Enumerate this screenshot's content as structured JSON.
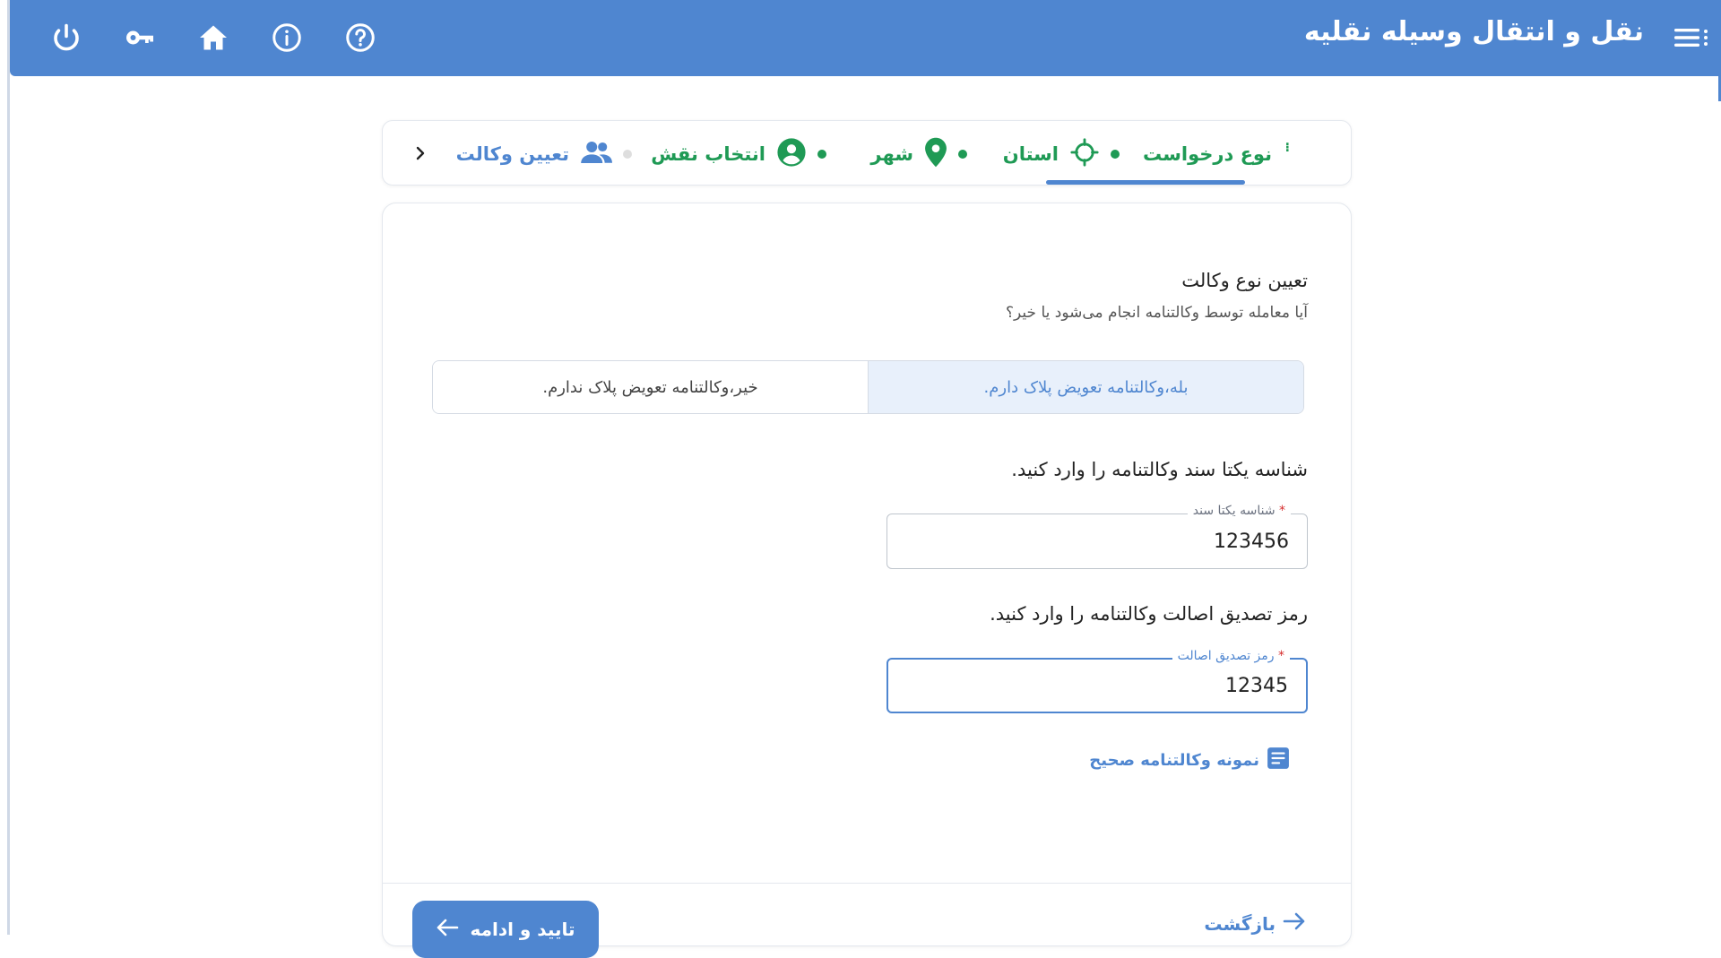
{
  "header": {
    "title": "نقل و انتقال وسیله نقلیه",
    "menu_icon": "menu-icon",
    "icons": [
      "power-icon",
      "key-icon",
      "home-icon",
      "info-icon",
      "help-icon"
    ],
    "color": "#4f86d0"
  },
  "stepper": {
    "steps": [
      {
        "label": "نوع درخواست",
        "state": "done"
      },
      {
        "label": "استان",
        "state": "done"
      },
      {
        "label": "شهر",
        "state": "done"
      },
      {
        "label": "انتخاب نقش",
        "state": "done"
      },
      {
        "label": "تعیین وکالت",
        "state": "current"
      }
    ],
    "colors": {
      "done": "#1f9a55",
      "current": "#4f86d0"
    }
  },
  "form": {
    "title": "تعیین نوع وکالت",
    "subtitle": "آیا معامله توسط وکالتنامه انجام می‌شود یا خیر؟",
    "toggle": {
      "yes": "بله،وکالتنامه تعویض پلاک دارم.",
      "no": "خیر،وکالتنامه تعویض پلاک ندارم.",
      "selected": "yes"
    },
    "doc_id": {
      "prompt": "شناسه یکتا سند وکالتنامه را وارد کنید.",
      "legend": "شناسه یکتا سند",
      "required_mark": "*",
      "value": "123456"
    },
    "auth_code": {
      "prompt": "رمز تصدیق اصالت وکالتنامه را وارد کنید.",
      "legend": "رمز تصدیق اصالت",
      "required_mark": "*",
      "value": "12345"
    },
    "sample_link": "نمونه وکالتنامه صحیح"
  },
  "footer": {
    "confirm_label": "تایید و ادامه",
    "back_label": "بازگشت"
  }
}
